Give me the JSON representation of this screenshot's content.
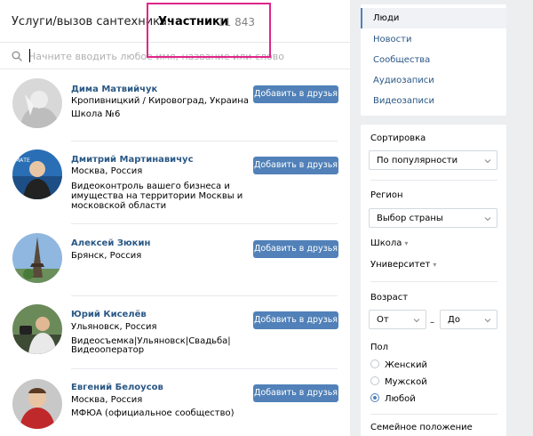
{
  "header": {
    "group_title": "Услуги/вызов сантехника..",
    "current": "Участники",
    "count": "11 843"
  },
  "search": {
    "placeholder": "Начните вводить любое имя, название или слово"
  },
  "add_label": "Добавить в друзья",
  "people": [
    {
      "name": "Дима Матвийчук",
      "lines": [
        "Кропивницкий / Кировоград, Украина",
        "Школа №6"
      ]
    },
    {
      "name": "Дмитрий Мартинавичус",
      "lines": [
        "Москва, Россия",
        "Видеоконтроль вашего бизнеса и",
        "имущества на территории Москвы и",
        "московской области"
      ]
    },
    {
      "name": "Алексей Зюкин",
      "lines": [
        "Брянск, Россия"
      ]
    },
    {
      "name": "Юрий Киселёв",
      "lines": [
        "Ульяновск, Россия",
        "Видеосъемка|Ульяновск|Свадьба|",
        "Видеооператор"
      ]
    },
    {
      "name": "Евгений Белоусов",
      "lines": [
        "Москва, Россия",
        "МФЮА (официальное сообщество)"
      ]
    }
  ],
  "nav": [
    "Люди",
    "Новости",
    "Сообщества",
    "Аудиозаписи",
    "Видеозаписи"
  ],
  "filters": {
    "sort_label": "Сортировка",
    "sort_value": "По популярности",
    "region_label": "Регион",
    "region_value": "Выбор страны",
    "school_label": "Школа",
    "university_label": "Университет",
    "age_label": "Возраст",
    "age_from": "От",
    "age_dash": "–",
    "age_to": "До",
    "gender_label": "Пол",
    "gender_options": [
      "Женский",
      "Мужской",
      "Любой"
    ],
    "gender_selected": "Любой",
    "family_label": "Семейное положение"
  },
  "colors": {
    "accent": "#5181b8",
    "link": "#2a5885",
    "highlight": "#e0258a",
    "bg": "#edeef0"
  }
}
